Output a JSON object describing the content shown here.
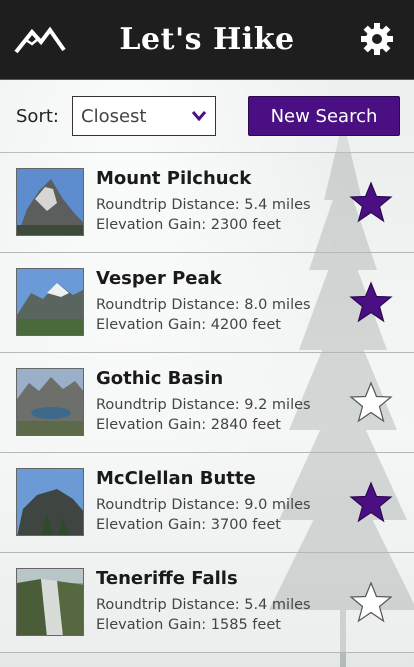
{
  "header": {
    "title": "Let's Hike",
    "logo_icon": "mountain-icon",
    "settings_icon": "gear-icon"
  },
  "sort": {
    "label": "Sort:",
    "selected": "Closest"
  },
  "new_search_label": "New Search",
  "colors": {
    "accent": "#4a0f82",
    "header_bg": "#1e1e1e"
  },
  "hikes": [
    {
      "name": "Mount Pilchuck",
      "distance": "Roundtrip Distance: 5.4 miles",
      "elevation": "Elevation Gain: 2300 feet",
      "favorite": true
    },
    {
      "name": "Vesper Peak",
      "distance": "Roundtrip Distance: 8.0 miles",
      "elevation": "Elevation Gain: 4200 feet",
      "favorite": true
    },
    {
      "name": "Gothic Basin",
      "distance": "Roundtrip Distance: 9.2 miles",
      "elevation": "Elevation Gain: 2840 feet",
      "favorite": false
    },
    {
      "name": "McClellan Butte",
      "distance": "Roundtrip Distance: 9.0 miles",
      "elevation": "Elevation Gain: 3700 feet",
      "favorite": true
    },
    {
      "name": "Teneriffe Falls",
      "distance": "Roundtrip Distance: 5.4 miles",
      "elevation": "Elevation Gain: 1585 feet",
      "favorite": false
    }
  ]
}
